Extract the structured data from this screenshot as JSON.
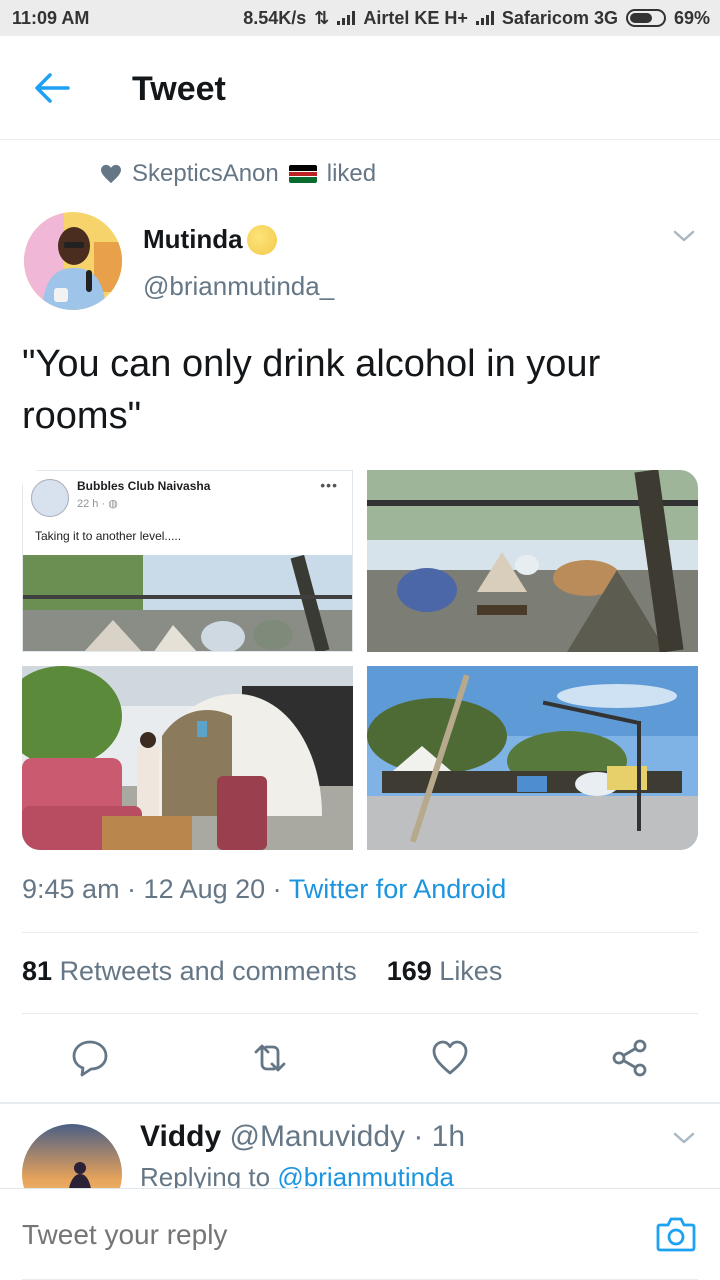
{
  "status_bar": {
    "time": "11:09 AM",
    "network_speed": "8.54K/s",
    "carrier1": "Airtel KE H+",
    "carrier2": "Safaricom 3G",
    "battery": "69%",
    "battery_level": 0.69
  },
  "header": {
    "title": "Tweet"
  },
  "social_context": {
    "user": "SkepticsAnon",
    "action": "liked"
  },
  "author": {
    "name": "Mutinda",
    "handle": "@brianmutinda_"
  },
  "tweet": {
    "text": "\"You can only drink alcohol in your rooms\"",
    "embedded_post": {
      "page_name": "Bubbles Club Naivasha",
      "time": "22 h ·",
      "caption": "Taking it to another level....."
    },
    "timestamp": "9:45 am · 12 Aug 20 ·",
    "source": "Twitter for Android",
    "retweets_count": "81",
    "retweets_label": "Retweets and comments",
    "likes_count": "169",
    "likes_label": "Likes"
  },
  "reply_preview": {
    "name": "Viddy",
    "handle_time": "@Manuviddy · 1h",
    "replying_prefix": "Replying to",
    "replying_to": "@brianmutinda"
  },
  "composer": {
    "placeholder": "Tweet your reply"
  },
  "colors": {
    "accent": "#1b95e0",
    "secondary_text": "#657786",
    "primary_text": "#14171a"
  }
}
